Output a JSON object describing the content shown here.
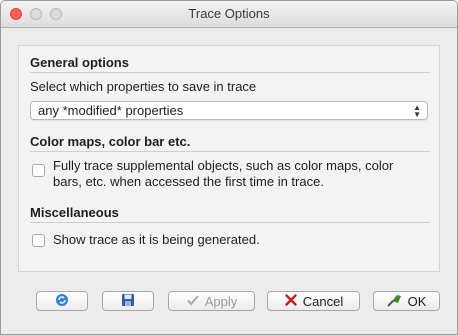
{
  "window": {
    "title": "Trace Options"
  },
  "general": {
    "heading": "General options",
    "select_label": "Select which properties to save in trace",
    "select_value": "any *modified* properties"
  },
  "colormaps": {
    "heading": "Color maps, color bar etc.",
    "checkbox_line1": "Fully trace supplemental objects, such as color maps, color",
    "checkbox_line2": "bars, etc. when accessed the first time in trace.",
    "checked": false
  },
  "misc": {
    "heading": "Miscellaneous",
    "checkbox_label": "Show trace as it is being generated.",
    "checked": false
  },
  "buttons": {
    "apply": "Apply",
    "cancel": "Cancel",
    "ok": "OK"
  },
  "icons": {
    "refresh": "refresh-icon",
    "save": "save-icon",
    "apply": "checkmark-icon",
    "cancel": "x-icon",
    "ok": "ok-thumb-icon"
  },
  "colors": {
    "close": "#fc5f57",
    "refresh_icon": "#2f7fd8",
    "save_icon": "#2f5fa0",
    "cancel_x": "#c0201d",
    "ok_icon": "#3b8a2c"
  }
}
